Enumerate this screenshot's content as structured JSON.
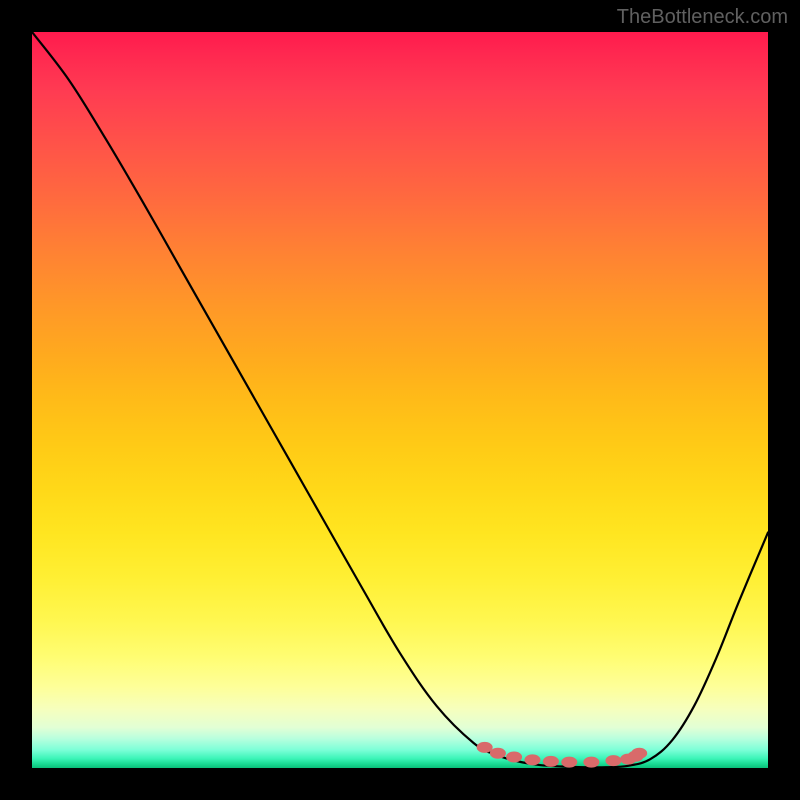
{
  "attribution": "TheBottleneck.com",
  "chart_data": {
    "type": "line",
    "title": "",
    "xlabel": "",
    "ylabel": "",
    "series": [
      {
        "name": "bottleneck-curve",
        "x": [
          0.0,
          0.05,
          0.1,
          0.15,
          0.2,
          0.25,
          0.3,
          0.35,
          0.4,
          0.45,
          0.5,
          0.55,
          0.6,
          0.63,
          0.66,
          0.69,
          0.72,
          0.75,
          0.78,
          0.81,
          0.84,
          0.87,
          0.9,
          0.93,
          0.96,
          1.0
        ],
        "y": [
          1.0,
          0.935,
          0.855,
          0.77,
          0.682,
          0.594,
          0.506,
          0.418,
          0.33,
          0.242,
          0.156,
          0.084,
          0.034,
          0.018,
          0.009,
          0.004,
          0.002,
          0.001,
          0.001,
          0.003,
          0.012,
          0.038,
          0.085,
          0.15,
          0.225,
          0.32
        ]
      },
      {
        "name": "highlight-dots",
        "x": [
          0.615,
          0.633,
          0.655,
          0.68,
          0.705,
          0.73,
          0.76,
          0.79,
          0.82,
          0.81,
          0.825
        ],
        "y": [
          0.028,
          0.02,
          0.015,
          0.011,
          0.009,
          0.008,
          0.008,
          0.01,
          0.016,
          0.012,
          0.02
        ]
      }
    ],
    "xlim": [
      0,
      1
    ],
    "ylim": [
      0,
      1
    ],
    "gradient_colors": {
      "top": "#ff1a4d",
      "mid": "#ffe520",
      "bottom": "#0bbf7a"
    },
    "highlight_dot_color": "#d96a6a"
  }
}
